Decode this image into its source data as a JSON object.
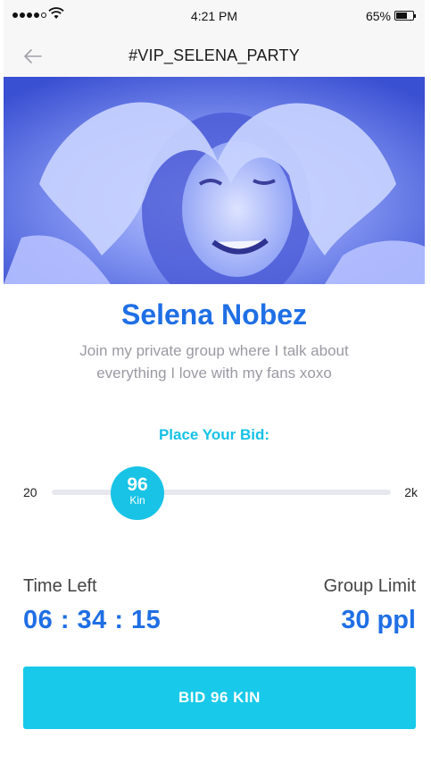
{
  "status_bar": {
    "time": "4:21 PM",
    "battery_percent": "65%",
    "signal_bars_filled": 4,
    "signal_bars_total": 5
  },
  "nav": {
    "back_icon": "arrow-left-icon",
    "title": "#VIP_SELENA_PARTY"
  },
  "hero": {
    "image": "heart-hands-photo"
  },
  "profile": {
    "name": "Selena Nobez",
    "bio": "Join my private group where I talk about everything I love with my fans xoxo"
  },
  "bid": {
    "label": "Place Your Bid:",
    "min": "20",
    "max": "2k",
    "value": "96",
    "unit": "Kin"
  },
  "stats": {
    "time_left_label": "Time Left",
    "time_left_value": "06 : 34 : 15",
    "group_limit_label": "Group Limit",
    "group_limit_value": "30 ppl"
  },
  "cta": {
    "label": "BID 96 KIN"
  },
  "colors": {
    "primary_blue": "#1f6fe5",
    "accent_cyan": "#18c9e9",
    "muted_text": "#9a9aa3"
  }
}
